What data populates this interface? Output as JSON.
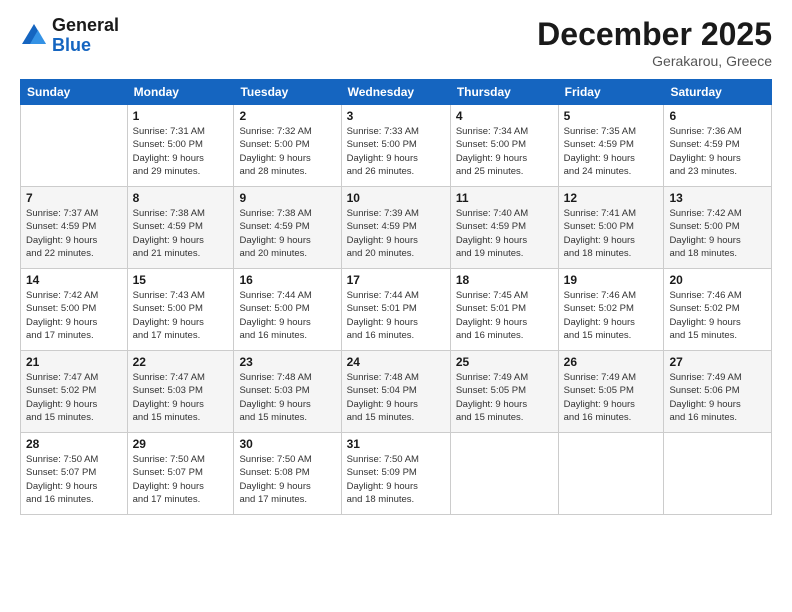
{
  "logo": {
    "line1": "General",
    "line2": "Blue"
  },
  "title": "December 2025",
  "location": "Gerakarou, Greece",
  "weekdays": [
    "Sunday",
    "Monday",
    "Tuesday",
    "Wednesday",
    "Thursday",
    "Friday",
    "Saturday"
  ],
  "weeks": [
    [
      {
        "day": "",
        "info": ""
      },
      {
        "day": "1",
        "info": "Sunrise: 7:31 AM\nSunset: 5:00 PM\nDaylight: 9 hours\nand 29 minutes."
      },
      {
        "day": "2",
        "info": "Sunrise: 7:32 AM\nSunset: 5:00 PM\nDaylight: 9 hours\nand 28 minutes."
      },
      {
        "day": "3",
        "info": "Sunrise: 7:33 AM\nSunset: 5:00 PM\nDaylight: 9 hours\nand 26 minutes."
      },
      {
        "day": "4",
        "info": "Sunrise: 7:34 AM\nSunset: 5:00 PM\nDaylight: 9 hours\nand 25 minutes."
      },
      {
        "day": "5",
        "info": "Sunrise: 7:35 AM\nSunset: 4:59 PM\nDaylight: 9 hours\nand 24 minutes."
      },
      {
        "day": "6",
        "info": "Sunrise: 7:36 AM\nSunset: 4:59 PM\nDaylight: 9 hours\nand 23 minutes."
      }
    ],
    [
      {
        "day": "7",
        "info": "Sunrise: 7:37 AM\nSunset: 4:59 PM\nDaylight: 9 hours\nand 22 minutes."
      },
      {
        "day": "8",
        "info": "Sunrise: 7:38 AM\nSunset: 4:59 PM\nDaylight: 9 hours\nand 21 minutes."
      },
      {
        "day": "9",
        "info": "Sunrise: 7:38 AM\nSunset: 4:59 PM\nDaylight: 9 hours\nand 20 minutes."
      },
      {
        "day": "10",
        "info": "Sunrise: 7:39 AM\nSunset: 4:59 PM\nDaylight: 9 hours\nand 20 minutes."
      },
      {
        "day": "11",
        "info": "Sunrise: 7:40 AM\nSunset: 4:59 PM\nDaylight: 9 hours\nand 19 minutes."
      },
      {
        "day": "12",
        "info": "Sunrise: 7:41 AM\nSunset: 5:00 PM\nDaylight: 9 hours\nand 18 minutes."
      },
      {
        "day": "13",
        "info": "Sunrise: 7:42 AM\nSunset: 5:00 PM\nDaylight: 9 hours\nand 18 minutes."
      }
    ],
    [
      {
        "day": "14",
        "info": "Sunrise: 7:42 AM\nSunset: 5:00 PM\nDaylight: 9 hours\nand 17 minutes."
      },
      {
        "day": "15",
        "info": "Sunrise: 7:43 AM\nSunset: 5:00 PM\nDaylight: 9 hours\nand 17 minutes."
      },
      {
        "day": "16",
        "info": "Sunrise: 7:44 AM\nSunset: 5:00 PM\nDaylight: 9 hours\nand 16 minutes."
      },
      {
        "day": "17",
        "info": "Sunrise: 7:44 AM\nSunset: 5:01 PM\nDaylight: 9 hours\nand 16 minutes."
      },
      {
        "day": "18",
        "info": "Sunrise: 7:45 AM\nSunset: 5:01 PM\nDaylight: 9 hours\nand 16 minutes."
      },
      {
        "day": "19",
        "info": "Sunrise: 7:46 AM\nSunset: 5:02 PM\nDaylight: 9 hours\nand 15 minutes."
      },
      {
        "day": "20",
        "info": "Sunrise: 7:46 AM\nSunset: 5:02 PM\nDaylight: 9 hours\nand 15 minutes."
      }
    ],
    [
      {
        "day": "21",
        "info": "Sunrise: 7:47 AM\nSunset: 5:02 PM\nDaylight: 9 hours\nand 15 minutes."
      },
      {
        "day": "22",
        "info": "Sunrise: 7:47 AM\nSunset: 5:03 PM\nDaylight: 9 hours\nand 15 minutes."
      },
      {
        "day": "23",
        "info": "Sunrise: 7:48 AM\nSunset: 5:03 PM\nDaylight: 9 hours\nand 15 minutes."
      },
      {
        "day": "24",
        "info": "Sunrise: 7:48 AM\nSunset: 5:04 PM\nDaylight: 9 hours\nand 15 minutes."
      },
      {
        "day": "25",
        "info": "Sunrise: 7:49 AM\nSunset: 5:05 PM\nDaylight: 9 hours\nand 15 minutes."
      },
      {
        "day": "26",
        "info": "Sunrise: 7:49 AM\nSunset: 5:05 PM\nDaylight: 9 hours\nand 16 minutes."
      },
      {
        "day": "27",
        "info": "Sunrise: 7:49 AM\nSunset: 5:06 PM\nDaylight: 9 hours\nand 16 minutes."
      }
    ],
    [
      {
        "day": "28",
        "info": "Sunrise: 7:50 AM\nSunset: 5:07 PM\nDaylight: 9 hours\nand 16 minutes."
      },
      {
        "day": "29",
        "info": "Sunrise: 7:50 AM\nSunset: 5:07 PM\nDaylight: 9 hours\nand 17 minutes."
      },
      {
        "day": "30",
        "info": "Sunrise: 7:50 AM\nSunset: 5:08 PM\nDaylight: 9 hours\nand 17 minutes."
      },
      {
        "day": "31",
        "info": "Sunrise: 7:50 AM\nSunset: 5:09 PM\nDaylight: 9 hours\nand 18 minutes."
      },
      {
        "day": "",
        "info": ""
      },
      {
        "day": "",
        "info": ""
      },
      {
        "day": "",
        "info": ""
      }
    ]
  ]
}
